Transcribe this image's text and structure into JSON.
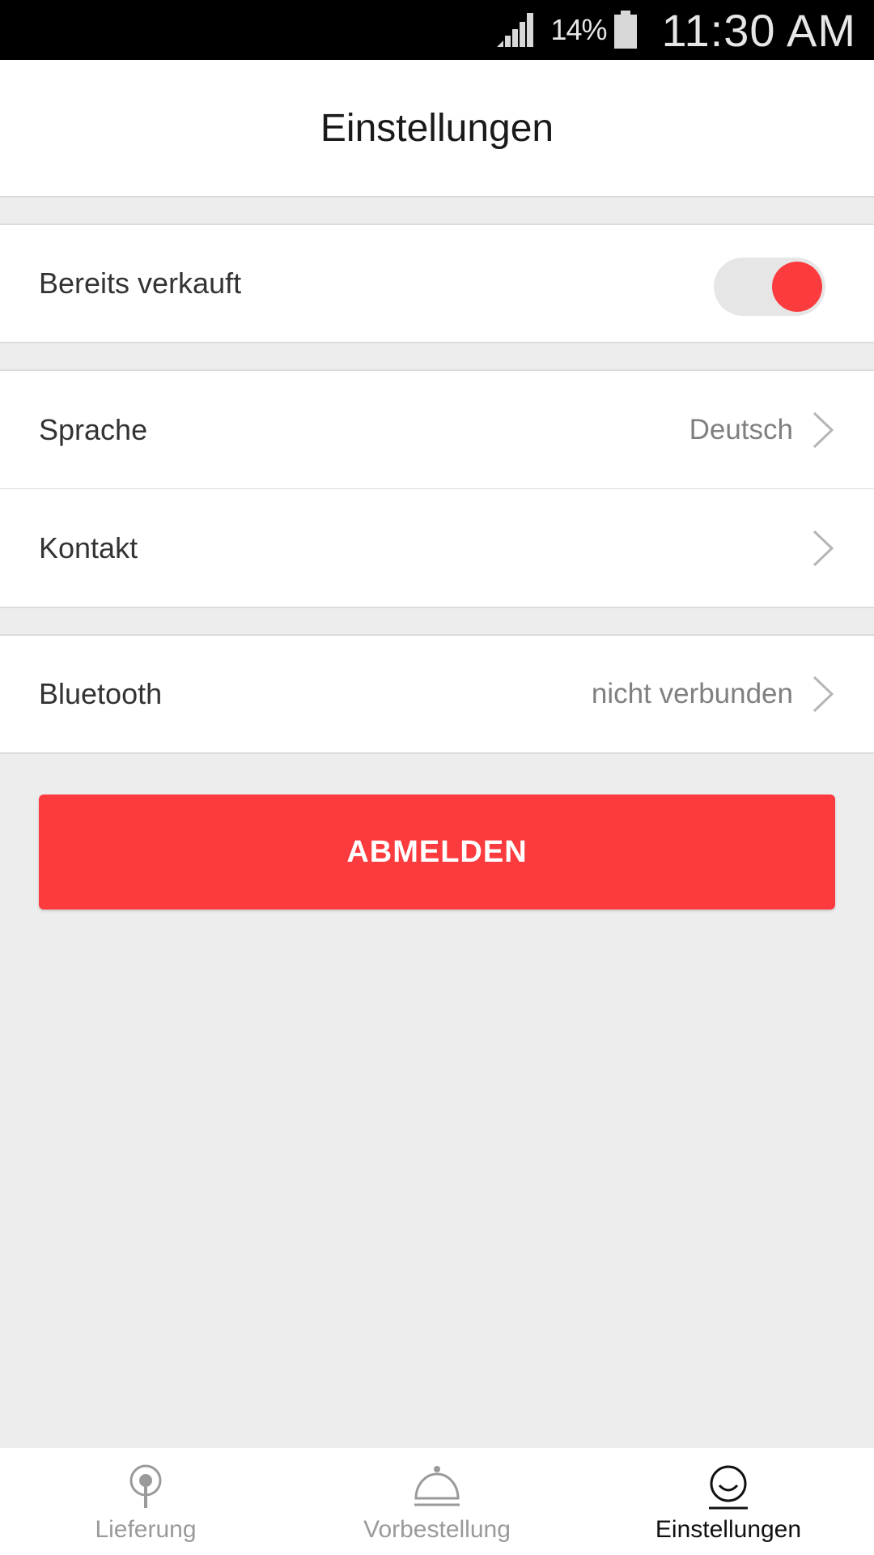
{
  "status_bar": {
    "battery": "14%",
    "time": "11:30 AM"
  },
  "header": {
    "title": "Einstellungen"
  },
  "settings": {
    "sold_out": {
      "label": "Bereits verkauft",
      "enabled": true
    },
    "language": {
      "label": "Sprache",
      "value": "Deutsch"
    },
    "contact": {
      "label": "Kontakt"
    },
    "bluetooth": {
      "label": "Bluetooth",
      "value": "nicht verbunden"
    }
  },
  "logout": {
    "label": "ABMELDEN"
  },
  "nav": {
    "items": [
      {
        "label": "Lieferung",
        "icon": "delivery-pin-icon",
        "active": false
      },
      {
        "label": "Vorbestellung",
        "icon": "service-bell-icon",
        "active": false
      },
      {
        "label": "Einstellungen",
        "icon": "smiley-icon",
        "active": true
      }
    ]
  },
  "colors": {
    "accent": "#fc3b3e",
    "background": "#ededed"
  }
}
